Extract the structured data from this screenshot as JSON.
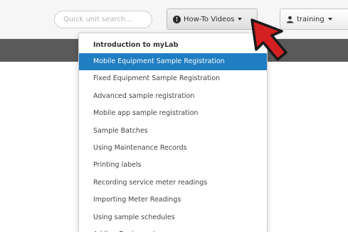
{
  "search": {
    "placeholder": "Quick unit search..."
  },
  "toolbar": {
    "howto_label": "How-To Videos",
    "user_label": "training"
  },
  "menu": {
    "header": "Introduction to myLab",
    "items": [
      {
        "label": "Mobile Equipment Sample Registration",
        "active": true
      },
      {
        "label": "Fixed Equipment Sample Registration"
      },
      {
        "label": "Advanced sample registration"
      },
      {
        "label": "Mobile app sample registration"
      },
      {
        "label": "Sample Batches"
      },
      {
        "label": "Using Maintenance Records"
      },
      {
        "label": "Printing labels"
      },
      {
        "label": "Recording service meter readings"
      },
      {
        "label": "Importing Meter Readings"
      },
      {
        "label": "Using sample schedules"
      },
      {
        "label": "Adding Equipment"
      }
    ]
  },
  "colors": {
    "accent": "#1f7dc1",
    "header_bar": "#5a5a5a",
    "pointer_arrow": "#d42020"
  },
  "icons": {
    "howto": "info-circle-icon",
    "user": "user-icon",
    "pointer": "red-arrow-cursor-icon"
  }
}
